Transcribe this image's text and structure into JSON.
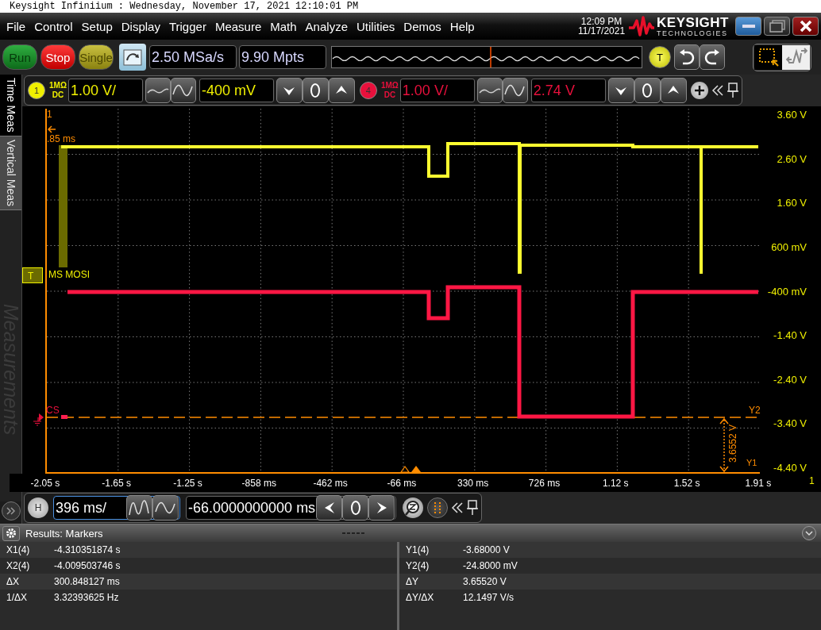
{
  "window": {
    "title": "Keysight Infiniium : Wednesday, November 17, 2021 12:10:01 PM"
  },
  "menu": [
    "File",
    "Control",
    "Setup",
    "Display",
    "Trigger",
    "Measure",
    "Math",
    "Analyze",
    "Utilities",
    "Demos",
    "Help"
  ],
  "clock": {
    "time": "12:09 PM",
    "date": "11/17/2021"
  },
  "logo": {
    "name": "KEYSIGHT",
    "tagline": "TECHNOLOGIES"
  },
  "toolbar": {
    "buttons": [
      {
        "label": "Run",
        "kind": "run"
      },
      {
        "label": "Stop",
        "kind": "stop"
      },
      {
        "label": "Single",
        "kind": "single"
      }
    ],
    "sample_rate": "2.50 MSa/s",
    "memory_depth": "9.90 Mpts",
    "trigger_button": "T"
  },
  "side_tabs": [
    {
      "label": "Time Meas",
      "selected": true
    },
    {
      "label": "Vertical Meas",
      "selected": false
    }
  ],
  "side_panel_title": "Measurements",
  "channels": [
    {
      "number": "1",
      "color": "#f0f000",
      "impedance": "1MΩ",
      "coupling": "DC",
      "scale": "1.00 V/",
      "offset": "-400 mV"
    },
    {
      "number": "4",
      "color": "#e8103c",
      "impedance": "1MΩ",
      "coupling": "DC",
      "scale": "1.00 V/",
      "offset": "2.74 V"
    }
  ],
  "plot": {
    "y_labels": [
      "3.60 V",
      "2.60 V",
      "1.60 V",
      "600 mV",
      "-400 mV",
      "-1.40 V",
      "-2.40 V",
      "-3.40 V",
      "-4.40 V"
    ],
    "x_labels": [
      "-2.05 s",
      "-1.65 s",
      "-1.25 s",
      "-858 ms",
      "-462 ms",
      "-66 ms",
      "330 ms",
      "726 ms",
      "1.12 s",
      "1.52 s",
      "1.91 s"
    ],
    "x_marker_number": "1",
    "x_marker_time": ".85 ms",
    "y2_label": "Y2",
    "y1_label": "Y1",
    "delta_label": "3.6552 V",
    "corner_label": "1",
    "trigger_marker": "T",
    "trace_labels": [
      {
        "label": "MS MOSI",
        "color": "#f0f000"
      },
      {
        "label": "CS",
        "color": "#e8103c"
      }
    ]
  },
  "horizontal": {
    "button": "H",
    "scale": "396 ms/",
    "position": "-66.0000000000 ms"
  },
  "results": {
    "title": "Results: Markers",
    "rows": [
      {
        "label": "X1(4)",
        "value": "-4.310351874 s",
        "label_2": "Y1(4)",
        "value_2": "-3.68000 V"
      },
      {
        "label": "X2(4)",
        "value": "-4.009503746 s",
        "label_2": "Y2(4)",
        "value_2": "-24.8000 mV"
      },
      {
        "label": "ΔX",
        "value": "300.848127 ms",
        "label_2": "ΔY",
        "value_2": "3.65520 V"
      },
      {
        "label": "1/ΔX",
        "value": "3.32393625 Hz",
        "label_2": "ΔY/ΔX",
        "value_2": "12.1497 V/s"
      }
    ]
  }
}
